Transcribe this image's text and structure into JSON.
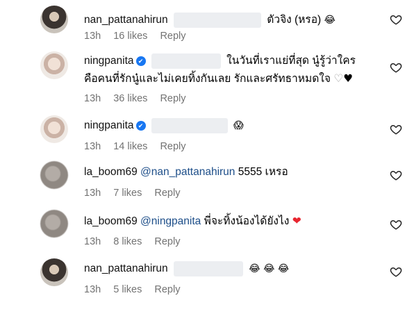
{
  "comments": [
    {
      "username": "nan_pattanahirun",
      "text": "ตัวจิง (หรอ)",
      "emoji": "😂",
      "time": "13h",
      "likes": "16 likes",
      "reply": "Reply",
      "avatar": "nan-avatar"
    },
    {
      "username": "ningpanita",
      "verified": true,
      "text_line1": "ในวันที่เราแย่ที่สุด นู๋รู้ว่าใคร",
      "text_line2": "คือคนที่รักนู๋และไม่เคยทิ้งกันเลย รักและศรัทธาหมดใจ",
      "heart_outline": "♡",
      "heart_black": "♥",
      "time": "13h",
      "likes": "36 likes",
      "reply": "Reply",
      "avatar": "ning-avatar"
    },
    {
      "username": "ningpanita",
      "verified": true,
      "emoji": "😱",
      "time": "13h",
      "likes": "14 likes",
      "reply": "Reply",
      "avatar": "ning-avatar"
    },
    {
      "username": "la_boom69",
      "mention": "@nan_pattanahirun",
      "text": "5555 เหรอ",
      "time": "13h",
      "likes": "7 likes",
      "reply": "Reply",
      "avatar": "boom-avatar"
    },
    {
      "username": "la_boom69",
      "mention": "@ningpanita",
      "text": "พี่จะทิ้งน้องได้ยังไง",
      "emoji": "❤",
      "time": "13h",
      "likes": "8 likes",
      "reply": "Reply",
      "avatar": "boom-avatar"
    },
    {
      "username": "nan_pattanahirun",
      "emoji": "😂 😂 😂",
      "time": "13h",
      "likes": "5 likes",
      "reply": "Reply",
      "avatar": "nan-avatar"
    }
  ],
  "like_icon": "heart-outline-icon",
  "colors": {
    "meta": "#737373",
    "mention": "#1d4e89",
    "verified": "#1877f2",
    "heart_red": "#e8252f"
  }
}
